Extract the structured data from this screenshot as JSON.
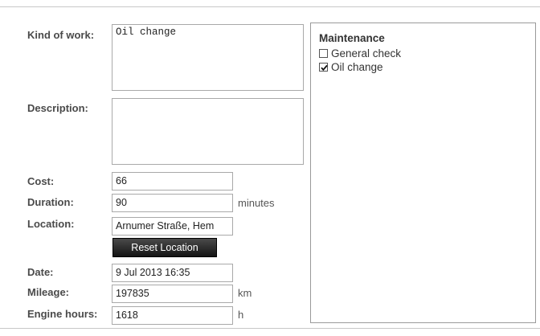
{
  "form": {
    "kind_of_work": {
      "label": "Kind of work:",
      "value": "Oil change"
    },
    "description": {
      "label": "Description:",
      "value": ""
    },
    "cost": {
      "label": "Cost:",
      "value": "66"
    },
    "duration": {
      "label": "Duration:",
      "value": "90",
      "unit": "minutes"
    },
    "location": {
      "label": "Location:",
      "value": "Arnumer Straße, Hem"
    },
    "reset_location_label": "Reset Location",
    "date": {
      "label": "Date:",
      "value": "9 Jul 2013 16:35"
    },
    "mileage": {
      "label": "Mileage:",
      "value": "197835",
      "unit": "km"
    },
    "engine_hours": {
      "label": "Engine hours:",
      "value": "1618",
      "unit": "h"
    }
  },
  "maintenance": {
    "title": "Maintenance",
    "items": [
      {
        "label": "General check",
        "checked": false
      },
      {
        "label": "Oil change",
        "checked": true
      }
    ]
  }
}
